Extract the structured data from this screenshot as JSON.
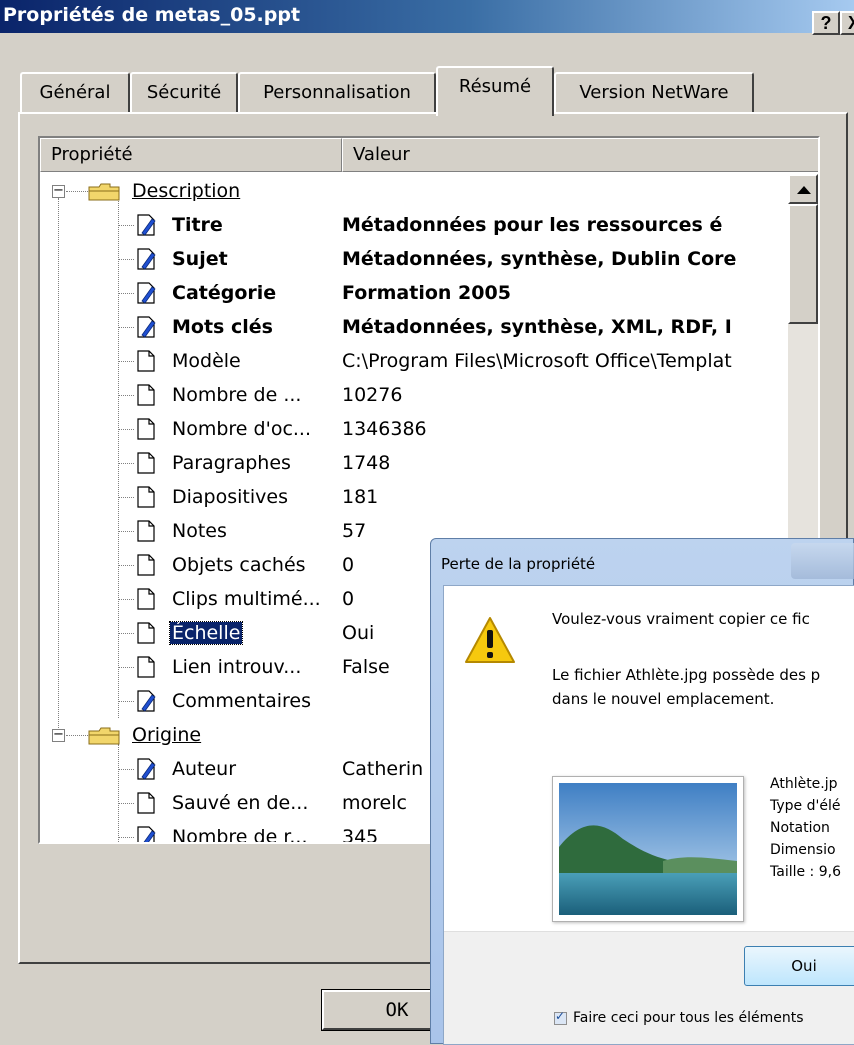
{
  "window": {
    "title": "Propriétés de metas_05.ppt",
    "help_label": "?",
    "close_label": "X"
  },
  "tabs": [
    {
      "label": "Général",
      "active": false
    },
    {
      "label": "Sécurité",
      "active": false
    },
    {
      "label": "Personnalisation",
      "active": false
    },
    {
      "label": "Résumé",
      "active": true
    },
    {
      "label": "Version NetWare",
      "active": false
    }
  ],
  "list": {
    "columns": [
      "Propriété",
      "Valeur"
    ],
    "groups": [
      {
        "name": "Description",
        "expander": "−"
      },
      {
        "name": "Origine",
        "expander": "−"
      }
    ],
    "rows": [
      {
        "name": "Titre",
        "value": "Métadonnées pour les ressources é",
        "icon": "edit-icon",
        "bold": true
      },
      {
        "name": "Sujet",
        "value": "Métadonnées, synthèse, Dublin Core",
        "icon": "edit-icon",
        "bold": true
      },
      {
        "name": "Catégorie",
        "value": "Formation 2005",
        "icon": "edit-icon",
        "bold": true
      },
      {
        "name": "Mots clés",
        "value": "Métadonnées, synthèse, XML, RDF, I",
        "icon": "edit-icon",
        "bold": true
      },
      {
        "name": "Modèle",
        "value": "C:\\Program Files\\Microsoft Office\\Templat",
        "icon": "document-icon",
        "bold": false
      },
      {
        "name": "Nombre de ...",
        "value": "10276",
        "icon": "document-icon",
        "bold": false
      },
      {
        "name": "Nombre d'oc...",
        "value": "1346386",
        "icon": "document-icon",
        "bold": false
      },
      {
        "name": "Paragraphes",
        "value": "1748",
        "icon": "document-icon",
        "bold": false
      },
      {
        "name": "Diapositives",
        "value": "181",
        "icon": "document-icon",
        "bold": false
      },
      {
        "name": "Notes",
        "value": "57",
        "icon": "document-icon",
        "bold": false
      },
      {
        "name": "Objets cachés",
        "value": "0",
        "icon": "document-icon",
        "bold": false
      },
      {
        "name": "Clips multimé...",
        "value": "0",
        "icon": "document-icon",
        "bold": false
      },
      {
        "name": "Échelle",
        "value": "Oui",
        "icon": "document-icon",
        "bold": false,
        "selected": true
      },
      {
        "name": "Lien introuv...",
        "value": "False",
        "icon": "document-icon",
        "bold": false
      },
      {
        "name": "Commentaires",
        "value": "",
        "icon": "edit-icon",
        "bold": false
      },
      {
        "name": "Auteur",
        "value": "Catherin",
        "icon": "edit-icon",
        "bold": false
      },
      {
        "name": "Sauvé en de...",
        "value": "morelc",
        "icon": "document-icon",
        "bold": false
      },
      {
        "name": "Nombre de r...",
        "value": "345",
        "icon": "edit-icon",
        "bold": false
      }
    ]
  },
  "ok_label": "OK",
  "overlay": {
    "title": "Perte de la propriété",
    "question": "Voulez-vous vraiment copier ce fic",
    "info_line1": "Le fichier Athlète.jpg possède des p",
    "info_line2": "dans le nouvel emplacement.",
    "meta": [
      "Athlète.jp",
      "Type d'élé",
      "Notation",
      "Dimensio",
      "Taille : 9,6"
    ],
    "yes_label": "Oui",
    "checkbox_label": "Faire ceci pour tous les éléments"
  },
  "colors": {
    "title_gradient_start": "#0a246a",
    "selection": "#0a246a",
    "face": "#d4d0c8"
  }
}
